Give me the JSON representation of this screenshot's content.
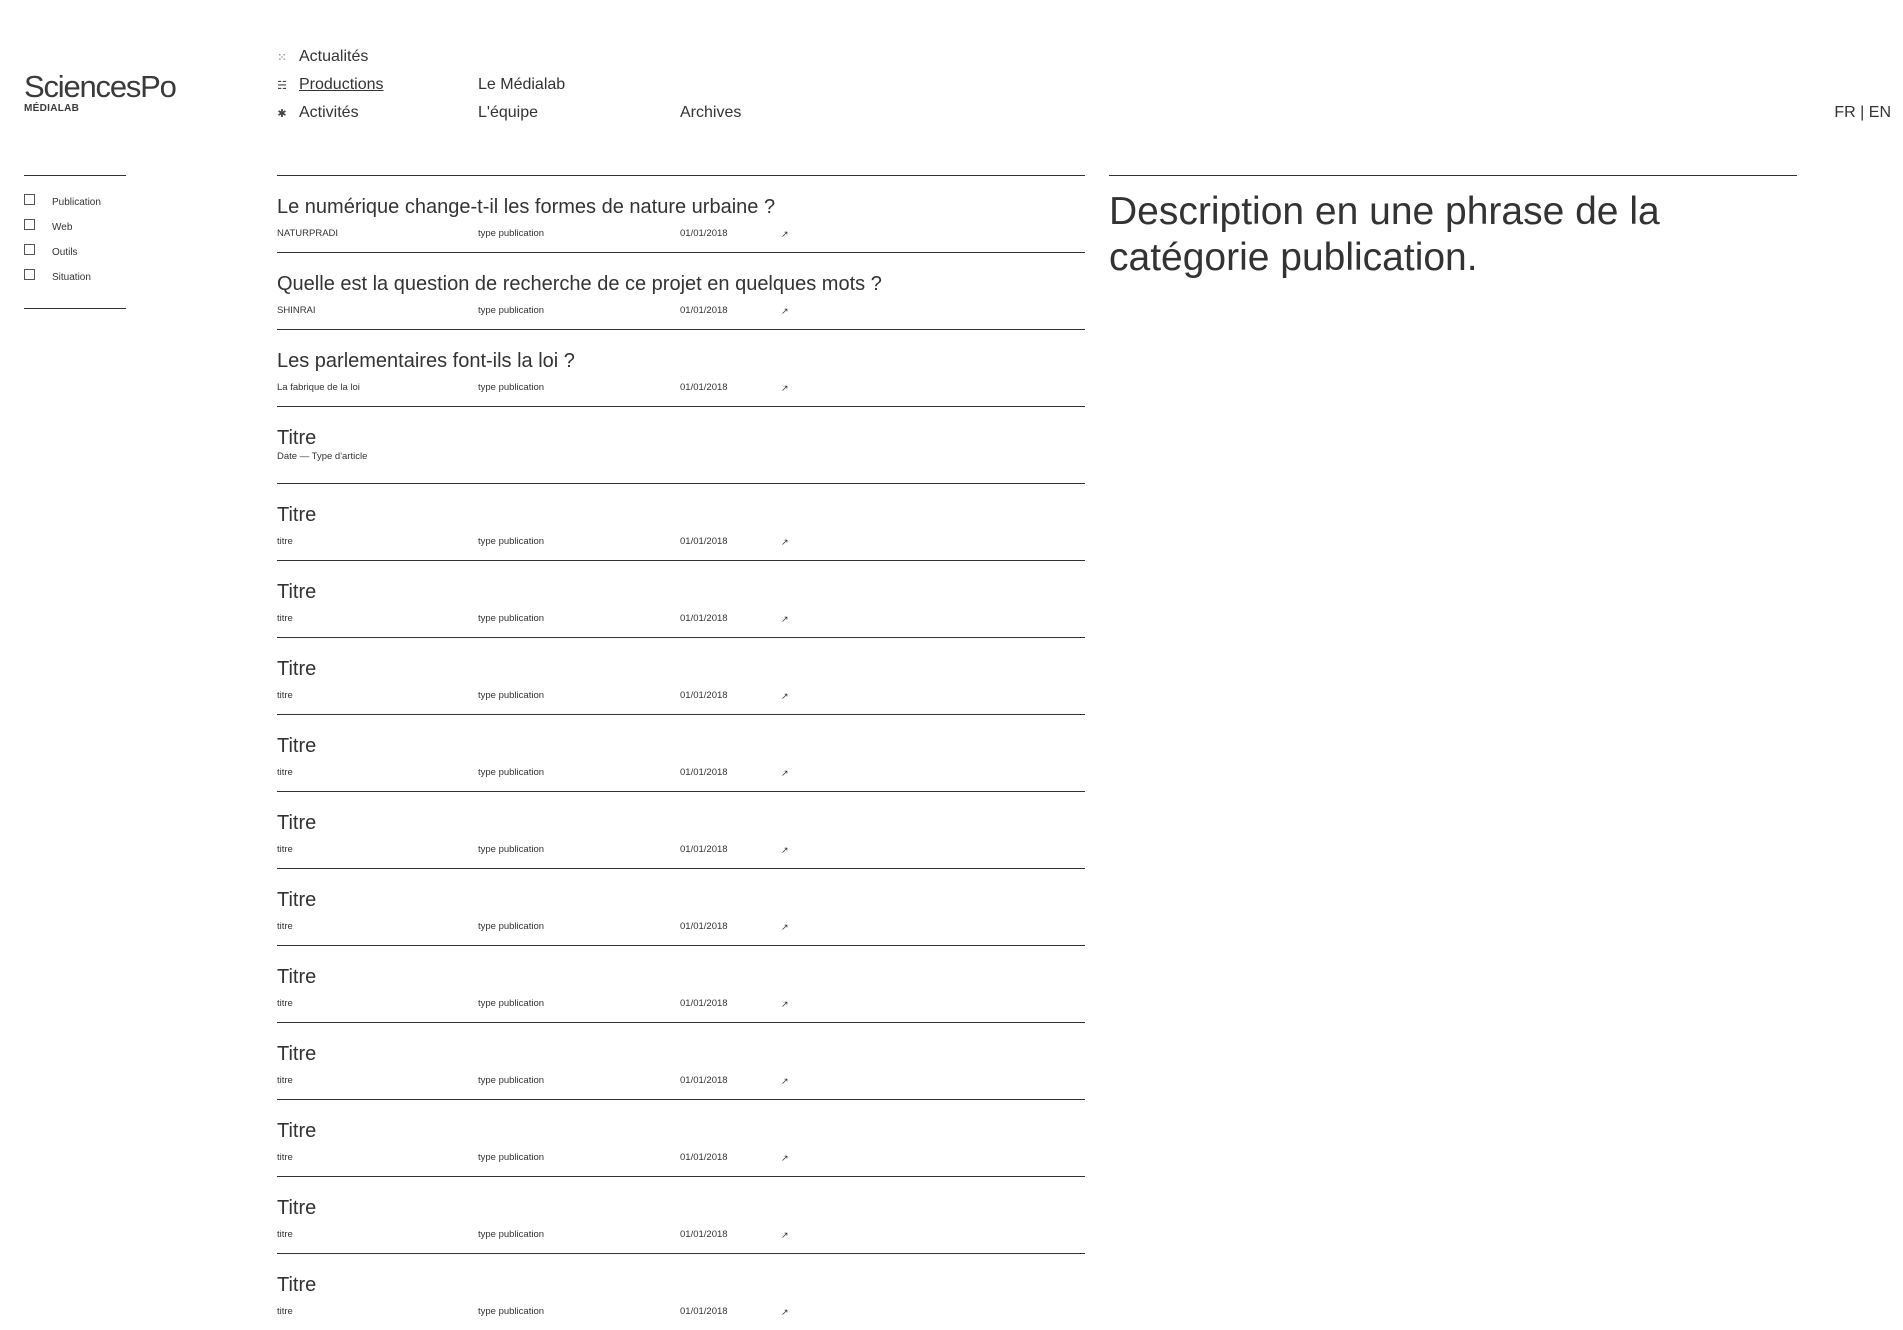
{
  "logo": {
    "main": "SciencesPo",
    "sub": "MÉDIALAB"
  },
  "nav": {
    "items": [
      {
        "icon": "dots-icon",
        "glyph": "⁙",
        "label": "Actualités",
        "underlined": false
      },
      {
        "icon": "list-icon",
        "glyph": "☵",
        "label": "Productions",
        "underlined": true
      },
      {
        "icon": "asterisk-icon",
        "glyph": "✱",
        "label": "Activités",
        "underlined": false
      }
    ],
    "secondary": [
      {
        "label": "Le Médialab"
      },
      {
        "label": "L'équipe"
      },
      {
        "label": "Archives"
      }
    ]
  },
  "lang": {
    "label": "FR | EN"
  },
  "filters": [
    {
      "label": "Publication",
      "checked": false
    },
    {
      "label": "Web",
      "checked": false
    },
    {
      "label": "Outils",
      "checked": false
    },
    {
      "label": "Situation",
      "checked": false
    }
  ],
  "rows": [
    {
      "title": "Le numérique change-t-il les formes de nature urbaine ?",
      "author": "NATURPRADI",
      "type": "type publication",
      "date": "01/01/2018",
      "arrow": "↗"
    },
    {
      "title": "Quelle est la question de recherche de ce projet en quelques mots ?",
      "author": "SHINRAI",
      "type": "type publication",
      "date": "01/01/2018",
      "arrow": "↗"
    },
    {
      "title": "Les parlementaires font-ils la loi ?",
      "author": "La fabrique de la loi",
      "type": "type publication",
      "date": "01/01/2018",
      "arrow": "↗"
    },
    {
      "title": "Titre",
      "datetype": "Date — Type d'article"
    },
    {
      "title": "Titre",
      "author": "titre",
      "type": "type publication",
      "date": "01/01/2018",
      "arrow": "↗"
    },
    {
      "title": "Titre",
      "author": "titre",
      "type": "type publication",
      "date": "01/01/2018",
      "arrow": "↗"
    },
    {
      "title": "Titre",
      "author": "titre",
      "type": "type publication",
      "date": "01/01/2018",
      "arrow": "↗"
    },
    {
      "title": "Titre",
      "author": "titre",
      "type": "type publication",
      "date": "01/01/2018",
      "arrow": "↗"
    },
    {
      "title": "Titre",
      "author": "titre",
      "type": "type publication",
      "date": "01/01/2018",
      "arrow": "↗"
    },
    {
      "title": "Titre",
      "author": "titre",
      "type": "type publication",
      "date": "01/01/2018",
      "arrow": "↗"
    },
    {
      "title": "Titre",
      "author": "titre",
      "type": "type publication",
      "date": "01/01/2018",
      "arrow": "↗"
    },
    {
      "title": "Titre",
      "author": "titre",
      "type": "type publication",
      "date": "01/01/2018",
      "arrow": "↗"
    },
    {
      "title": "Titre",
      "author": "titre",
      "type": "type publication",
      "date": "01/01/2018",
      "arrow": "↗"
    },
    {
      "title": "Titre",
      "author": "titre",
      "type": "type publication",
      "date": "01/01/2018",
      "arrow": "↗"
    },
    {
      "title": "Titre",
      "author": "titre",
      "type": "type publication",
      "date": "01/01/2018",
      "arrow": "↗"
    }
  ],
  "description": {
    "text": "Description en une phrase de la catégorie publication."
  }
}
